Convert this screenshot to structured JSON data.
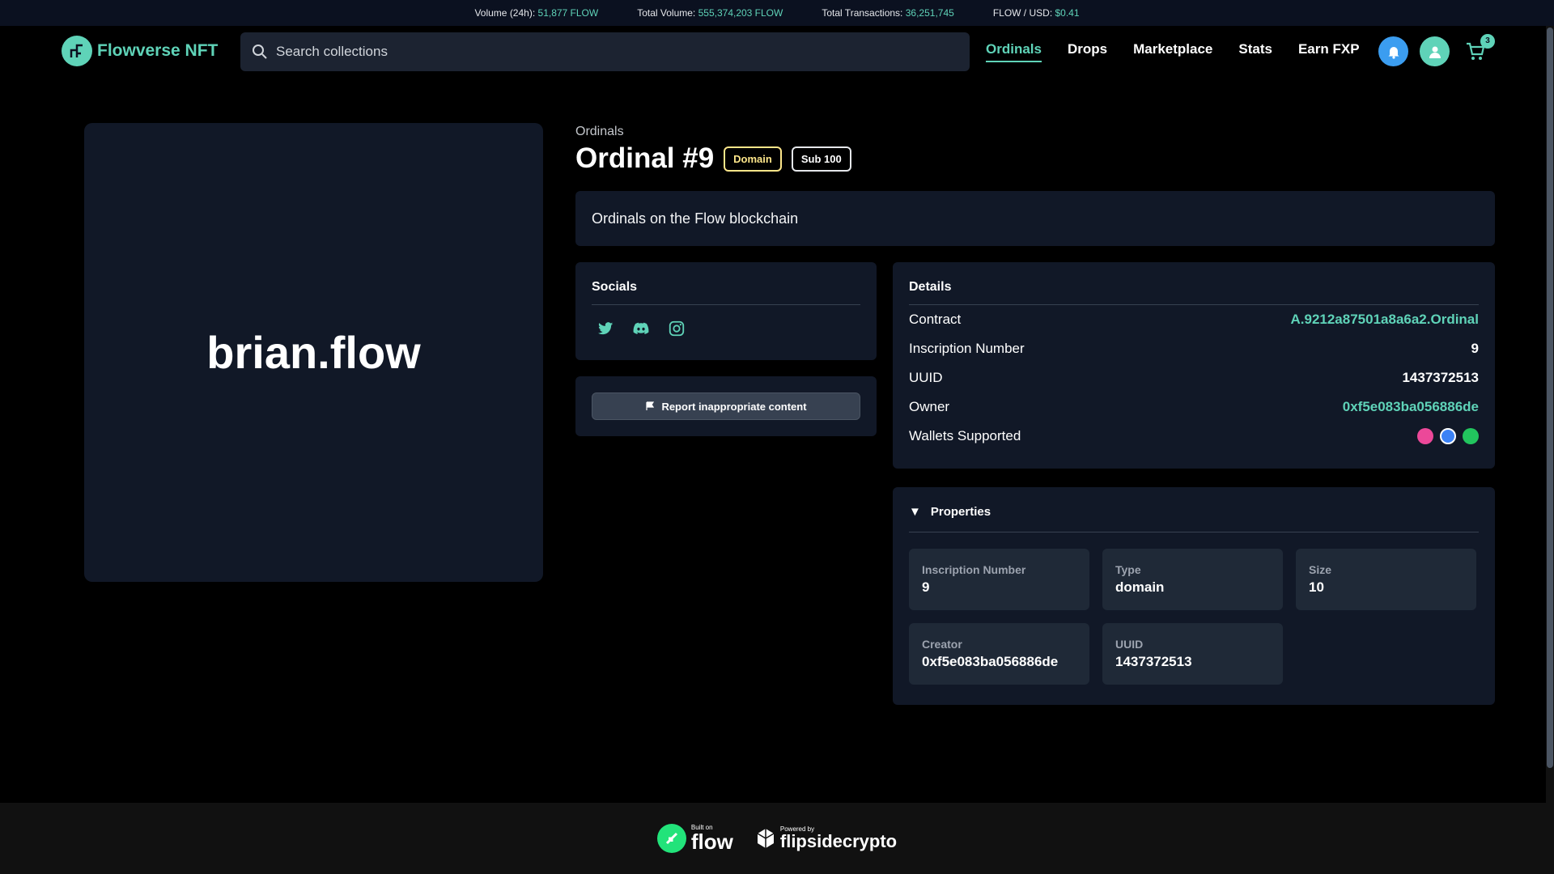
{
  "ticker": {
    "volume_label": "Volume (24h):",
    "volume_value": "51,877 FLOW",
    "total_volume_label": "Total Volume:",
    "total_volume_value": "555,374,203 FLOW",
    "total_tx_label": "Total Transactions:",
    "total_tx_value": "36,251,745",
    "price_label": "FLOW / USD:",
    "price_value": "$0.41"
  },
  "header": {
    "brand": "Flowverse NFT",
    "search_placeholder": "Search collections",
    "nav": [
      "Ordinals",
      "Drops",
      "Marketplace",
      "Stats",
      "Earn FXP"
    ],
    "active_nav": "Ordinals",
    "cart_count": "3"
  },
  "nft": {
    "display_name": "brian.flow",
    "collection": "Ordinals",
    "title": "Ordinal #9",
    "badges": [
      "Domain",
      "Sub 100"
    ],
    "description": "Ordinals on the Flow blockchain"
  },
  "socials": {
    "heading": "Socials",
    "icons": [
      "twitter-icon",
      "discord-icon",
      "instagram-icon"
    ]
  },
  "report": {
    "label": "Report inappropriate content"
  },
  "details": {
    "heading": "Details",
    "rows": [
      {
        "label": "Contract",
        "value": "A.9212a87501a8a6a2.Ordinal"
      },
      {
        "label": "Inscription Number",
        "value": "9"
      },
      {
        "label": "UUID",
        "value": "1437372513"
      },
      {
        "label": "Owner",
        "value": "0xf5e083ba056886de"
      },
      {
        "label": "Wallets Supported",
        "value": ""
      }
    ],
    "wallet_colors": [
      "#ec4899",
      "#3b82f6",
      "#22c55e"
    ]
  },
  "properties": {
    "heading": "Properties",
    "items": [
      {
        "key": "Inscription Number",
        "value": "9"
      },
      {
        "key": "Type",
        "value": "domain"
      },
      {
        "key": "Size",
        "value": "10"
      },
      {
        "key": "Creator",
        "value": "0xf5e083ba056886de"
      },
      {
        "key": "UUID",
        "value": "1437372513"
      }
    ]
  },
  "footer": {
    "built_small": "Built on",
    "built_big": "flow",
    "powered_small": "Powered by",
    "powered_big": "flipsidecrypto"
  },
  "colors": {
    "accent": "#5fd3b8",
    "panel": "#111827",
    "domain_badge": "#fde68a"
  }
}
